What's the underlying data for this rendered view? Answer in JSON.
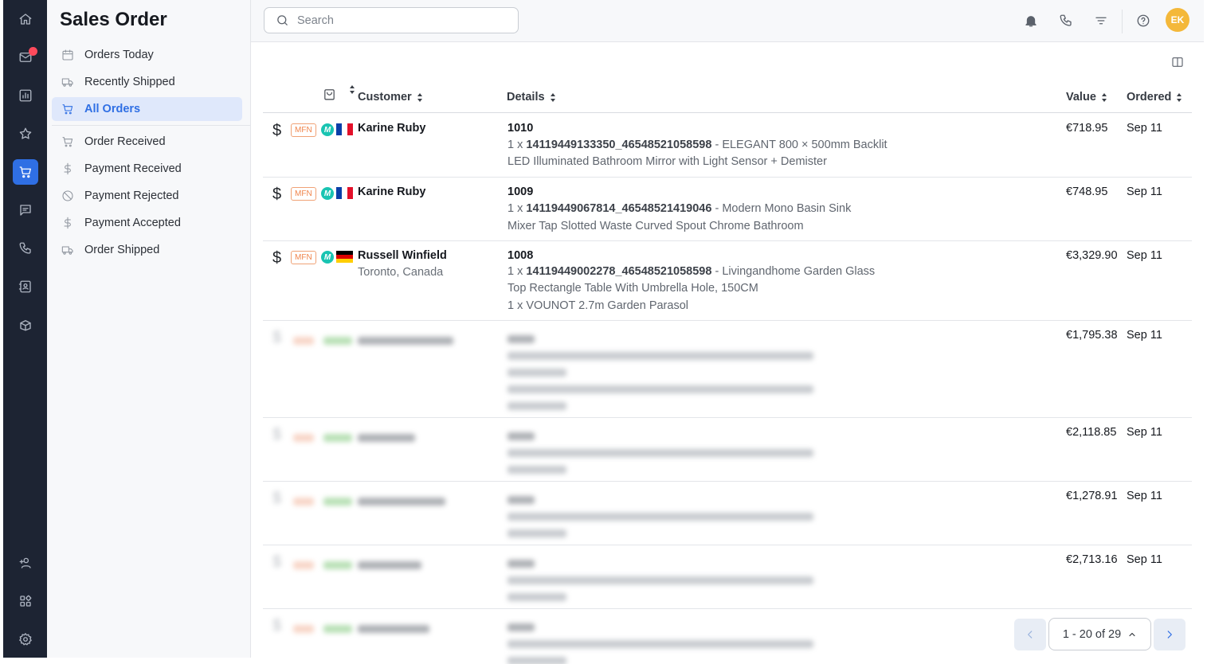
{
  "app": {
    "title": "Sales Order"
  },
  "rail": {
    "items": [
      {
        "icon": "home-icon",
        "active": false
      },
      {
        "icon": "mail-icon",
        "active": false,
        "notification": true
      },
      {
        "icon": "analytics-icon",
        "active": false
      },
      {
        "icon": "star-icon",
        "active": false
      },
      {
        "icon": "cart-icon",
        "active": true
      },
      {
        "icon": "chat-icon",
        "active": false
      },
      {
        "icon": "phone-icon",
        "active": false
      },
      {
        "icon": "contacts-icon",
        "active": false
      },
      {
        "icon": "inventory-icon",
        "active": false
      },
      {
        "icon": "add-user-icon",
        "active": false
      },
      {
        "icon": "apps-icon",
        "active": false
      },
      {
        "icon": "settings-icon",
        "active": false
      }
    ]
  },
  "sidebar": {
    "items": [
      {
        "label": "Orders Today",
        "icon": "calendar-icon"
      },
      {
        "label": "Recently Shipped",
        "icon": "truck-icon"
      },
      {
        "label": "All Orders",
        "icon": "cart-icon",
        "active": true
      },
      {
        "label": "Order Received",
        "icon": "cart-icon"
      },
      {
        "label": "Payment Received",
        "icon": "dollar-icon"
      },
      {
        "label": "Payment Rejected",
        "icon": "ban-icon"
      },
      {
        "label": "Payment Accepted",
        "icon": "dollar-icon"
      },
      {
        "label": "Order Shipped",
        "icon": "truck-icon"
      }
    ]
  },
  "search": {
    "placeholder": "Search",
    "value": ""
  },
  "avatar": {
    "initials": "EK",
    "color": "#f4b83a"
  },
  "table": {
    "columns": {
      "customer": "Customer",
      "details": "Details",
      "value": "Value",
      "ordered": "Ordered"
    },
    "rows": [
      {
        "payment_icon": "$",
        "channel": "MFN",
        "marketplace_icon": "M",
        "flag": "fr",
        "customer": "Karine Ruby",
        "location": "",
        "order_id": "1010",
        "lines": [
          {
            "qty": "1 x",
            "sku": "14119449133350_46548521058598",
            "desc": "- ELEGANT 800 × 500mm Backlit"
          },
          {
            "qty": "",
            "sku": "",
            "desc": "LED Illuminated Bathroom Mirror with Light Sensor + Demister"
          }
        ],
        "value": "€718.95",
        "ordered": "Sep 11"
      },
      {
        "payment_icon": "$",
        "channel": "MFN",
        "marketplace_icon": "M",
        "flag": "fr",
        "customer": "Karine Ruby",
        "location": "",
        "order_id": "1009",
        "lines": [
          {
            "qty": "1 x",
            "sku": "14119449067814_46548521419046",
            "desc": "- Modern Mono Basin Sink"
          },
          {
            "qty": "",
            "sku": "",
            "desc": "Mixer Tap Slotted Waste Curved Spout Chrome Bathroom"
          }
        ],
        "value": "€748.95",
        "ordered": "Sep 11"
      },
      {
        "payment_icon": "$",
        "channel": "MFN",
        "marketplace_icon": "M",
        "flag": "de",
        "customer": "Russell Winfield",
        "location": "Toronto, Canada",
        "order_id": "1008",
        "lines": [
          {
            "qty": "1 x",
            "sku": "14119449002278_46548521058598",
            "desc": "- Livingandhome Garden Glass"
          },
          {
            "qty": "",
            "sku": "",
            "desc": "Top Rectangle Table With Umbrella Hole, 150CM"
          },
          {
            "qty": "",
            "sku": "",
            "desc": "1 x VOUNOT 2.7m Garden Parasol"
          }
        ],
        "value": "€3,329.90",
        "ordered": "Sep 11"
      },
      {
        "blurred": true,
        "value": "€1,795.38",
        "ordered": "Sep 11"
      },
      {
        "blurred": true,
        "value": "€2,118.85",
        "ordered": "Sep 11"
      },
      {
        "blurred": true,
        "value": "€1,278.91",
        "ordered": "Sep 11"
      },
      {
        "blurred": true,
        "value": "€2,713.16",
        "ordered": "Sep 11"
      },
      {
        "blurred": true,
        "value": "",
        "ordered": ""
      }
    ]
  },
  "pagination": {
    "label": "1 - 20 of 29"
  }
}
